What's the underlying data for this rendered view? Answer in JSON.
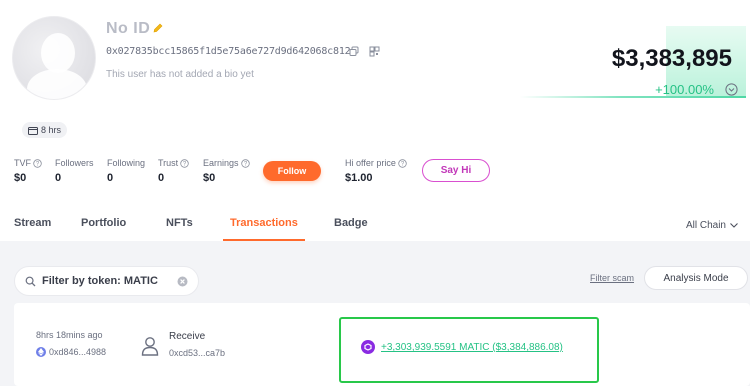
{
  "profile": {
    "name": "No ID",
    "address": "0x027835bcc15865f1d5e75a6e727d9d642068c812",
    "bio": "This user has not added a bio yet",
    "time_badge": "8 hrs"
  },
  "value": {
    "amount": "$3,383,895",
    "change": "+100.00%"
  },
  "stats": [
    {
      "label": "TVF",
      "value": "$0"
    },
    {
      "label": "Followers",
      "value": "0"
    },
    {
      "label": "Following",
      "value": "0"
    },
    {
      "label": "Trust",
      "value": "0"
    },
    {
      "label": "Earnings",
      "value": "$0"
    }
  ],
  "follow_label": "Follow",
  "hi_offer": {
    "label": "Hi offer price",
    "value": "$1.00"
  },
  "sayhi_label": "Say Hi",
  "tabs": [
    "Stream",
    "Portfolio",
    "NFTs",
    "Transactions",
    "Badge"
  ],
  "active_tab": "Transactions",
  "chain_select": "All Chain",
  "filter": {
    "text": "Filter by token: MATIC"
  },
  "filter_scam": "Filter scam",
  "analysis_mode": "Analysis Mode",
  "transaction": {
    "time": "8hrs 18mins ago",
    "hash": "0xd846...4988",
    "type": "Receive",
    "from": "0xcd53...ca7b",
    "amount": "+3,303,939.5591 MATIC ($3,384,886.08)"
  },
  "colors": {
    "accent": "#ff6a2c",
    "positive": "#25c285",
    "highlight": "#28c84a",
    "sayhi": "#d94fd0"
  }
}
